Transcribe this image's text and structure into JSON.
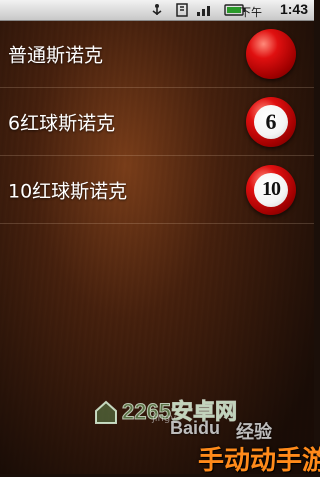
{
  "status_bar": {
    "ampm": "下午",
    "time": "1:43"
  },
  "menu": {
    "items": [
      {
        "label": "普通斯诺克",
        "ball_number": ""
      },
      {
        "label": "6红球斯诺克",
        "ball_number": "6"
      },
      {
        "label": "10红球斯诺克",
        "ball_number": "10"
      }
    ]
  },
  "watermarks": {
    "site": "2265安卓网",
    "site_url": "jingy",
    "baidu": "Baidu",
    "jingyan": "经验",
    "brand": "手动动手游"
  }
}
